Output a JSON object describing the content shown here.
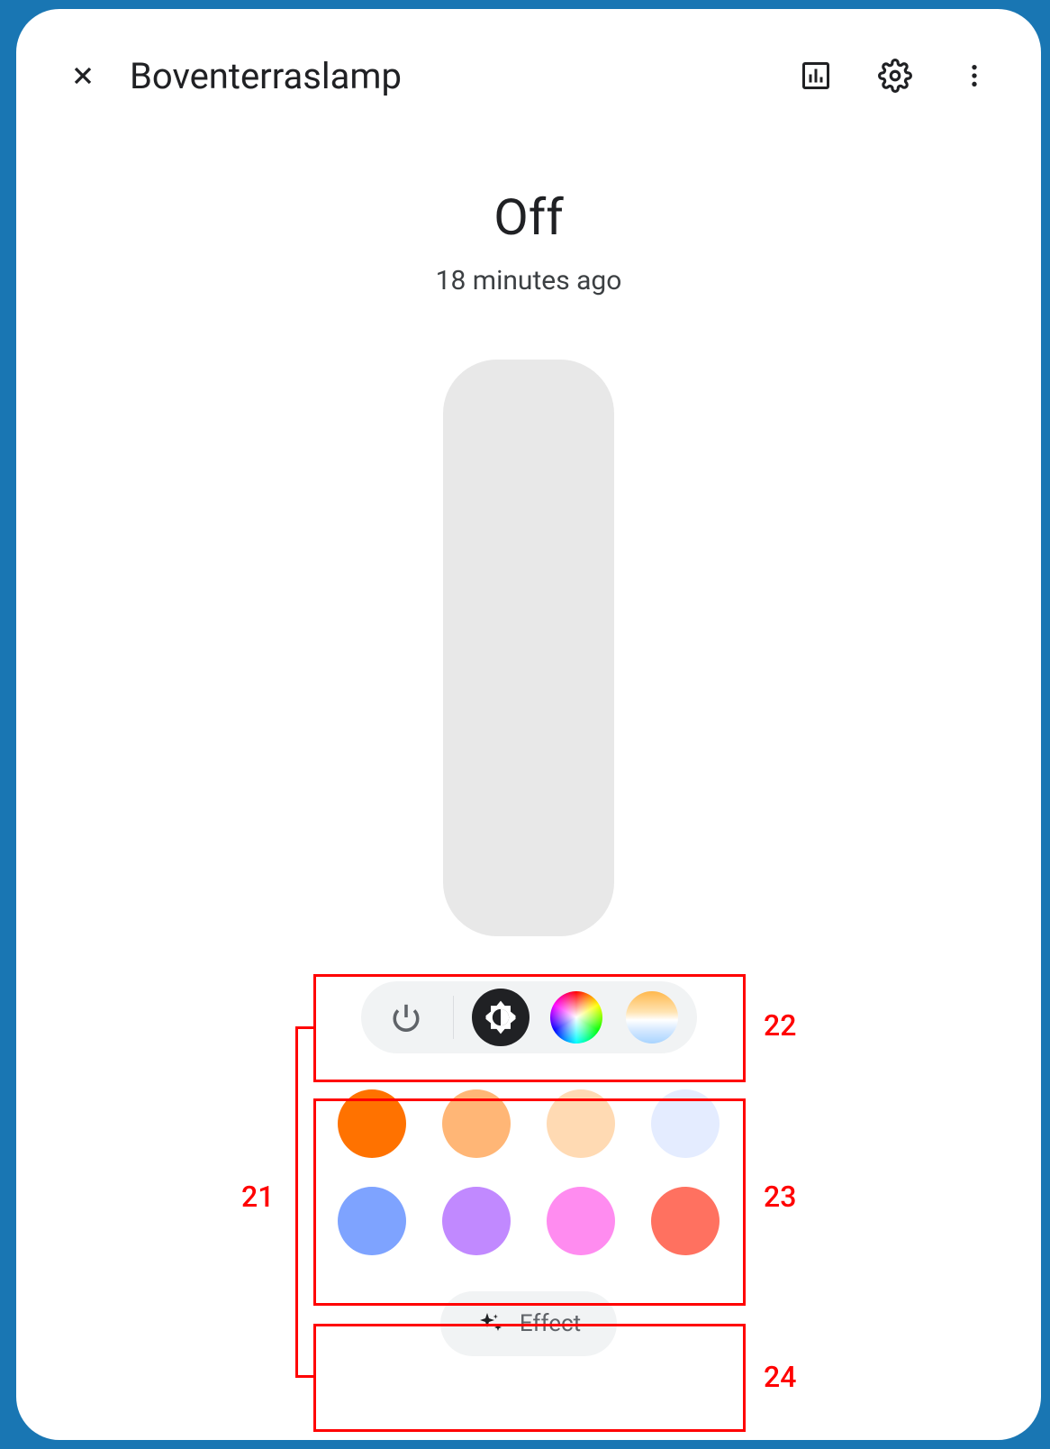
{
  "header": {
    "title": "Boventerraslamp"
  },
  "status": {
    "state": "Off",
    "time": "18 minutes ago"
  },
  "effect": {
    "label": "Effect"
  },
  "colors": [
    "#ff7200",
    "#ffb676",
    "#ffdab3",
    "#e4ecff",
    "#7ea3ff",
    "#c189ff",
    "#ff8cf0",
    "#ff7160"
  ],
  "annotations": {
    "group": "21",
    "toolbar": "22",
    "colors": "23",
    "effect": "24"
  }
}
